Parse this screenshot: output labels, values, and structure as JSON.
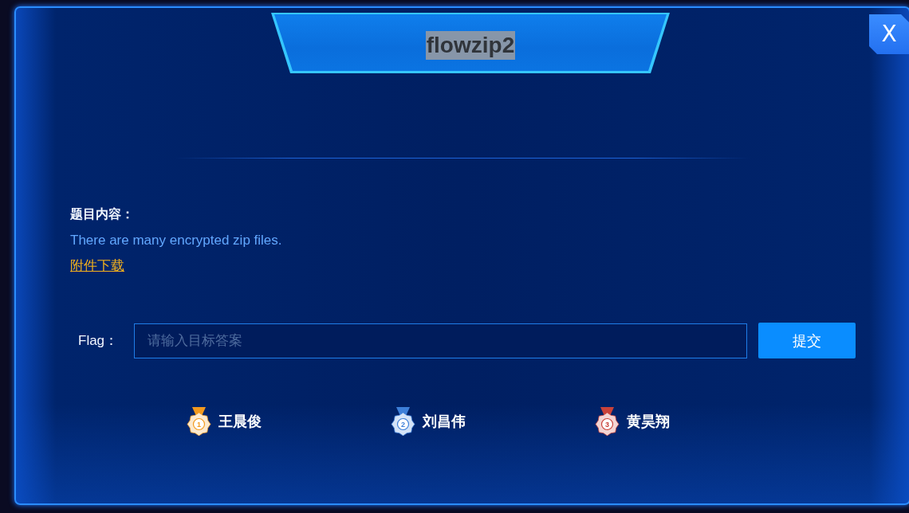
{
  "window": {
    "title": "flowzip2",
    "close_label": "X"
  },
  "challenge": {
    "content_label": "题目内容：",
    "description": "There are many encrypted zip files.",
    "attachment_link": "附件下载"
  },
  "flag_form": {
    "label": "Flag：",
    "placeholder": "请输入目标答案",
    "submit_label": "提交"
  },
  "ranking": [
    {
      "rank": "1",
      "name": "王晨俊",
      "color": "#f29a1f"
    },
    {
      "rank": "2",
      "name": "刘昌伟",
      "color": "#3d7fd9"
    },
    {
      "rank": "3",
      "name": "黄昊翔",
      "color": "#c9423a"
    }
  ]
}
